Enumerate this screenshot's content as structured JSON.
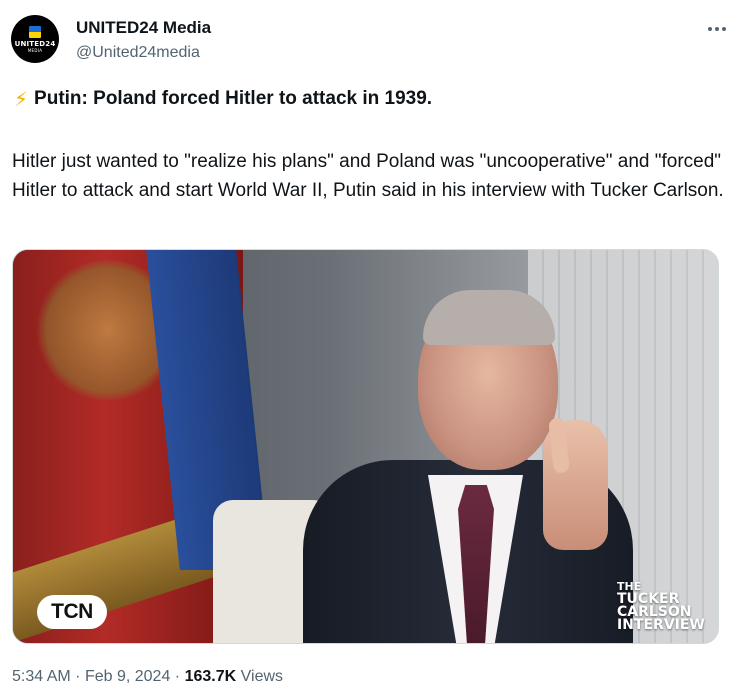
{
  "author": {
    "display_name": "UNITED24 Media",
    "handle": "@United24media",
    "avatar_logo_text": "UNITED24",
    "avatar_logo_subtext": "MEDIA",
    "avatar_flag_colors": [
      "#1d6fd8",
      "#ffd500"
    ]
  },
  "post": {
    "headline_icon": "lightning-bolt-icon",
    "headline_emoji": "⚡",
    "headline": "Putin: Poland forced Hitler to attack in 1939.",
    "body": "Hitler just wanted to \"realize his plans\" and Poland was \"uncooperative\" and \"forced\" Hitler to attack and start World War II, Putin said in his interview with Tucker Carlson."
  },
  "media": {
    "badge_left": "TCN",
    "watermark_line1": "THE",
    "watermark_line2": "TUCKER",
    "watermark_line3": "CARLSON",
    "watermark_line4": "INTERVIEW"
  },
  "footer": {
    "time": "5:34 AM",
    "separator": "·",
    "date": "Feb 9, 2024",
    "views_count": "163.7K",
    "views_label": "Views"
  },
  "menu": {
    "icon": "more-horizontal-icon"
  },
  "colors": {
    "text": "#0f1419",
    "secondary": "#536471",
    "border": "#cfd9de"
  }
}
